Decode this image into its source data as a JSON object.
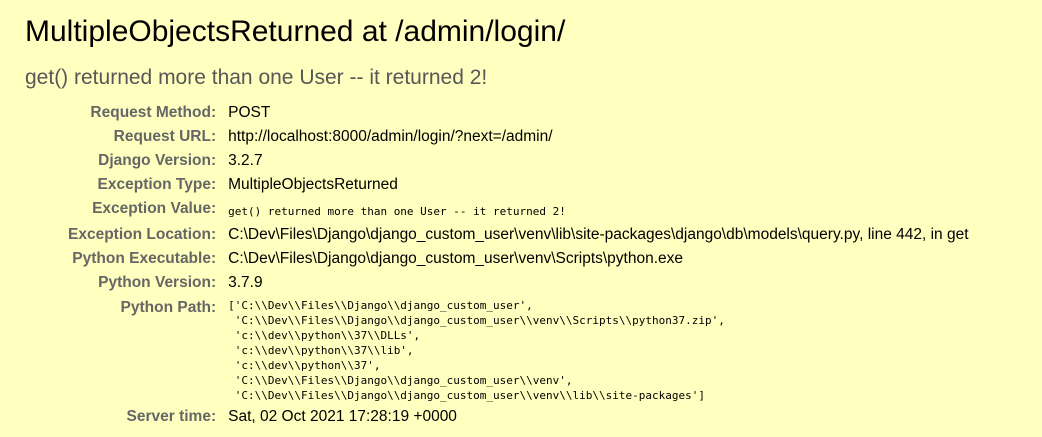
{
  "error": {
    "title": "MultipleObjectsReturned at /admin/login/",
    "message": "get() returned more than one User -- it returned 2!"
  },
  "meta": {
    "request_method": {
      "label": "Request Method:",
      "value": "POST"
    },
    "request_url": {
      "label": "Request URL:",
      "value": "http://localhost:8000/admin/login/?next=/admin/"
    },
    "django_version": {
      "label": "Django Version:",
      "value": "3.2.7"
    },
    "exception_type": {
      "label": "Exception Type:",
      "value": "MultipleObjectsReturned"
    },
    "exception_value": {
      "label": "Exception Value:",
      "value": "get() returned more than one User -- it returned 2!"
    },
    "exception_location": {
      "label": "Exception Location:",
      "value": "C:\\Dev\\Files\\Django\\django_custom_user\\venv\\lib\\site-packages\\django\\db\\models\\query.py, line 442, in get"
    },
    "python_executable": {
      "label": "Python Executable:",
      "value": "C:\\Dev\\Files\\Django\\django_custom_user\\venv\\Scripts\\python.exe"
    },
    "python_version": {
      "label": "Python Version:",
      "value": "3.7.9"
    },
    "python_path": {
      "label": "Python Path:",
      "lines": [
        "['C:\\\\Dev\\\\Files\\\\Django\\\\django_custom_user',",
        " 'C:\\\\Dev\\\\Files\\\\Django\\\\django_custom_user\\\\venv\\\\Scripts\\\\python37.zip',",
        " 'c:\\\\dev\\\\python\\\\37\\\\DLLs',",
        " 'c:\\\\dev\\\\python\\\\37\\\\lib',",
        " 'c:\\\\dev\\\\python\\\\37',",
        " 'C:\\\\Dev\\\\Files\\\\Django\\\\django_custom_user\\\\venv',",
        " 'C:\\\\Dev\\\\Files\\\\Django\\\\django_custom_user\\\\venv\\\\lib\\\\site-packages']"
      ]
    },
    "server_time": {
      "label": "Server time:",
      "value": "Sat, 02 Oct 2021 17:28:19 +0000"
    }
  },
  "colors": {
    "background": "#ffffc0",
    "label": "#666666",
    "subtitle": "#575757"
  }
}
